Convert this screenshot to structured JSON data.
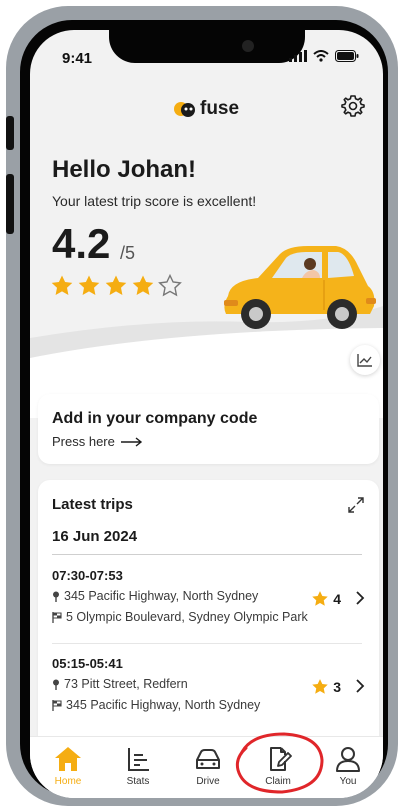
{
  "status_bar": {
    "time": "9:41"
  },
  "brand": {
    "name": "fuse",
    "accent": "#f5ad12"
  },
  "greeting": {
    "hello": "Hello Johan!",
    "subtitle": "Your latest trip score is excellent!",
    "score": "4.2",
    "score_max": "/5",
    "stars_filled": 4,
    "stars_total": 5
  },
  "company": {
    "title": "Add in your company code",
    "link": "Press here"
  },
  "trips": {
    "title": "Latest trips",
    "date": "16 Jun 2024",
    "items": [
      {
        "time": "07:30-07:53",
        "from": "345 Pacific Highway, North Sydney",
        "to": "5 Olympic Boulevard, Sydney Olympic Park",
        "score": "4"
      },
      {
        "time": "05:15-05:41",
        "from": "73 Pitt Street, Redfern",
        "to": "345 Pacific Highway, North Sydney",
        "score": "3"
      }
    ]
  },
  "tabs": [
    {
      "label": "Home",
      "icon": "home-icon",
      "active": true
    },
    {
      "label": "Stats",
      "icon": "stats-icon",
      "active": false
    },
    {
      "label": "Drive",
      "icon": "car-icon",
      "active": false
    },
    {
      "label": "Claim",
      "icon": "claim-icon",
      "active": false
    },
    {
      "label": "You",
      "icon": "user-icon",
      "active": false
    }
  ],
  "colors": {
    "star": "#f5ad12",
    "annotation": "#e0262a",
    "car": "#f5b31a"
  }
}
